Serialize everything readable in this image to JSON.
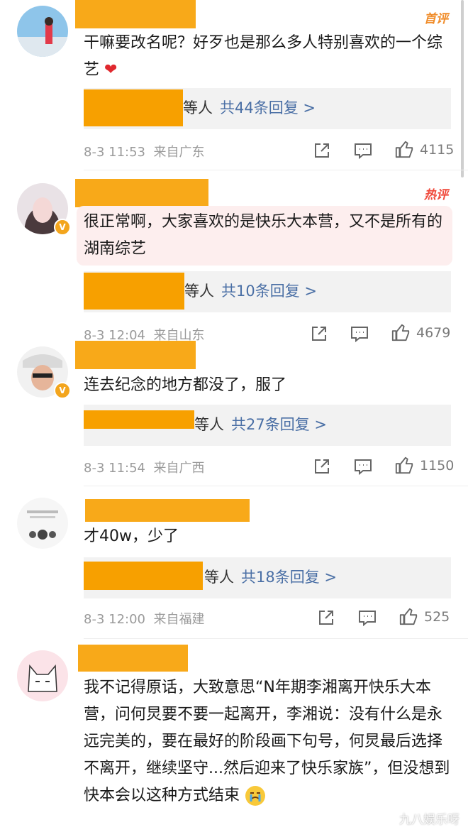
{
  "comments": [
    {
      "badge": "首评",
      "text": "干嘛要改名呢？好歹也是那么多人特别喜欢的一个综艺",
      "reply_who": "等人",
      "reply_count": "共44条回复 >",
      "time": "8-3 11:53",
      "location": "来自广东",
      "likes": "4115"
    },
    {
      "badge": "热评",
      "text": "很正常啊，大家喜欢的是快乐大本营，又不是所有的湖南综艺",
      "reply_who": "等人",
      "reply_count": "共10条回复 >",
      "time": "8-3 12:04",
      "location": "来自山东",
      "likes": "4679"
    },
    {
      "text": "连去纪念的地方都没了，服了",
      "reply_who": "等人",
      "reply_count": "共27条回复 >",
      "time": "8-3 11:54",
      "location": "来自广西",
      "likes": "1150"
    },
    {
      "text": "才40w，少了",
      "reply_who": "等人",
      "reply_count": "共18条回复 >",
      "time": "8-3 12:00",
      "location": "来自福建",
      "likes": "525"
    },
    {
      "text": "我不记得原话，大致意思“N年期李湘离开快乐大本营，问何炅要不要一起离开，李湘说：没有什么是永远完美的，要在最好的阶段画下句号，何炅最后选择不离开，继续坚守...然后迎来了快乐家族”，但没想到快本会以这种方式结束"
    }
  ],
  "watermark": "九八娱乐呀",
  "icons": {
    "share": "share-icon",
    "comment": "comment-icon",
    "like": "like-icon",
    "heart": "heart-emoji-icon",
    "cry": "crying-emoji-icon"
  }
}
